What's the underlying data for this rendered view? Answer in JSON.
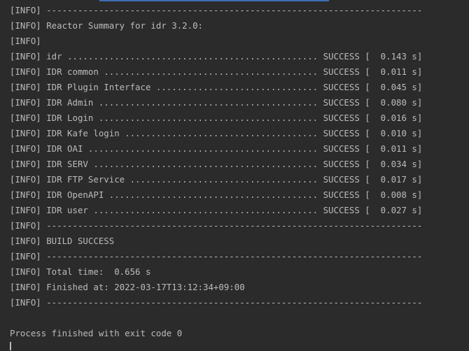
{
  "console": {
    "lines": [
      "[INFO] ------------------------------------------------------------------------",
      "[INFO] Reactor Summary for idr 3.2.0:",
      "[INFO]",
      "[INFO] idr ................................................ SUCCESS [  0.143 s]",
      "[INFO] IDR common ......................................... SUCCESS [  0.011 s]",
      "[INFO] IDR Plugin Interface ............................... SUCCESS [  0.045 s]",
      "[INFO] IDR Admin .......................................... SUCCESS [  0.080 s]",
      "[INFO] IDR Login .......................................... SUCCESS [  0.016 s]",
      "[INFO] IDR Kafe login ..................................... SUCCESS [  0.010 s]",
      "[INFO] IDR OAI ............................................ SUCCESS [  0.011 s]",
      "[INFO] IDR SERV ........................................... SUCCESS [  0.034 s]",
      "[INFO] IDR FTP Service .................................... SUCCESS [  0.017 s]",
      "[INFO] IDR OpenAPI ........................................ SUCCESS [  0.008 s]",
      "[INFO] IDR user ........................................... SUCCESS [  0.027 s]",
      "[INFO] ------------------------------------------------------------------------",
      "[INFO] BUILD SUCCESS",
      "[INFO] ------------------------------------------------------------------------",
      "[INFO] Total time:  0.656 s",
      "[INFO] Finished at: 2022-03-17T13:12:34+09:00",
      "[INFO] ------------------------------------------------------------------------"
    ],
    "exit_message": "Process finished with exit code 0"
  },
  "colors": {
    "background": "#2b2b2b",
    "text": "#bbbbbb",
    "accent": "#3d6fb4"
  }
}
